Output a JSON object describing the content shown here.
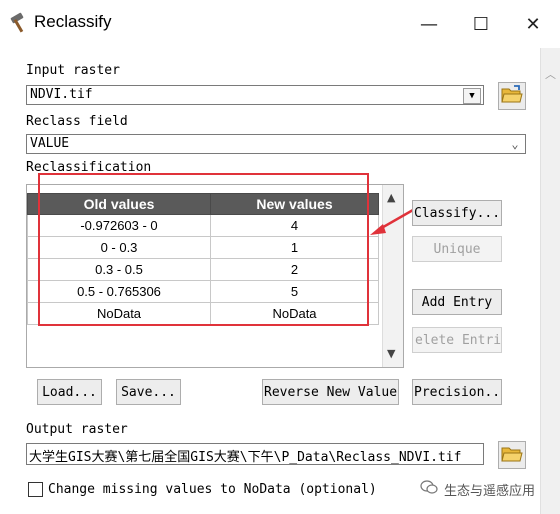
{
  "window": {
    "title": "Reclassify",
    "minimize_glyph": "—",
    "maximize_glyph": "☐",
    "close_glyph": "✕"
  },
  "input_raster": {
    "label": "Input raster",
    "value": "NDVI.tif"
  },
  "reclass_field": {
    "label": "Reclass field",
    "value": "VALUE"
  },
  "reclassification": {
    "label": "Reclassification",
    "columns": [
      "Old values",
      "New values"
    ],
    "rows": [
      {
        "old": "-0.972603 - 0",
        "new": "4"
      },
      {
        "old": "0 - 0.3",
        "new": "1"
      },
      {
        "old": "0.3 - 0.5",
        "new": "2"
      },
      {
        "old": "0.5 - 0.765306",
        "new": "5"
      },
      {
        "old": "NoData",
        "new": "NoData"
      }
    ]
  },
  "buttons": {
    "classify": "Classify...",
    "unique": "Unique",
    "add_entry": "Add Entry",
    "delete_entries": "elete Entrie",
    "load": "Load...",
    "save": "Save...",
    "reverse": "Reverse New Values",
    "precision": "Precision..."
  },
  "output_raster": {
    "label": "Output raster",
    "value": "大学生GIS大赛\\第七届全国GIS大赛\\下午\\P_Data\\Reclass_NDVI.tif"
  },
  "change_missing": {
    "label": "Change missing values to NoData (optional)",
    "checked": false
  },
  "watermark": {
    "text": "生态与遥感应用"
  },
  "colors": {
    "highlight": "#e0323a",
    "header_bg": "#5a5a5a"
  }
}
